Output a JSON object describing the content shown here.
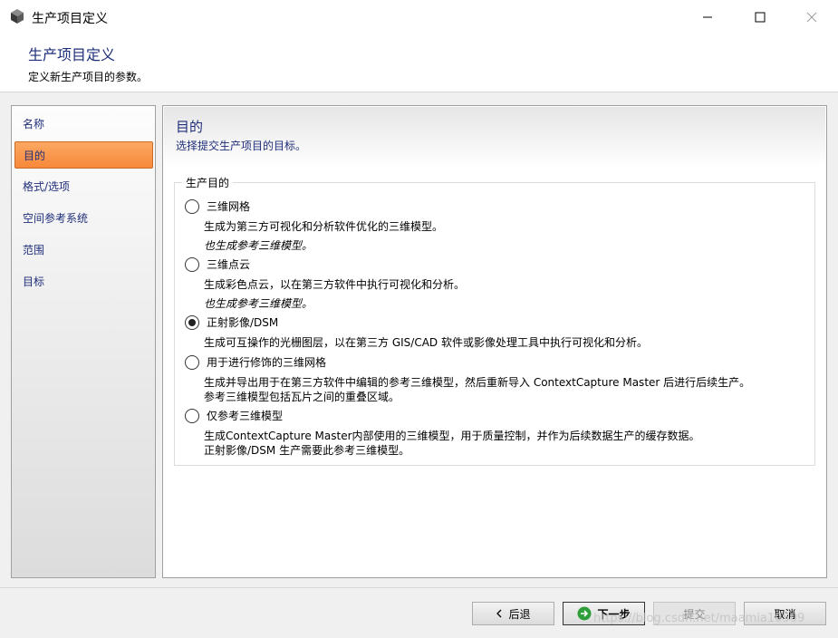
{
  "window": {
    "title": "生产项目定义"
  },
  "header": {
    "title": "生产项目定义",
    "subtitle": "定义新生产项目的参数。"
  },
  "sidebar": {
    "items": [
      {
        "label": "名称"
      },
      {
        "label": "目的"
      },
      {
        "label": "格式/选项"
      },
      {
        "label": "空间参考系统"
      },
      {
        "label": "范围"
      },
      {
        "label": "目标"
      }
    ],
    "active_label": "目的"
  },
  "main": {
    "title": "目的",
    "subtitle": "选择提交生产项目的目标。",
    "group_label": "生产目的",
    "options": [
      {
        "label": "三维网格",
        "checked": false,
        "desc": [
          "生成为第三方可视化和分析软件优化的三维模型。"
        ],
        "note": "也生成参考三维模型。"
      },
      {
        "label": "三维点云",
        "checked": false,
        "desc": [
          "生成彩色点云，以在第三方软件中执行可视化和分析。"
        ],
        "note": "也生成参考三维模型。"
      },
      {
        "label": "正射影像/DSM",
        "checked": true,
        "desc": [
          "生成可互操作的光栅图层，以在第三方 GIS/CAD 软件或影像处理工具中执行可视化和分析。"
        ]
      },
      {
        "label": "用于进行修饰的三维网格",
        "checked": false,
        "desc": [
          "生成并导出用于在第三方软件中编辑的参考三维模型，然后重新导入 ContextCapture Master 后进行后续生产。",
          "参考三维模型包括瓦片之间的重叠区域。"
        ]
      },
      {
        "label": "仅参考三维模型",
        "checked": false,
        "desc": [
          "生成ContextCapture Master内部使用的三维模型，用于质量控制，并作为后续数据生产的缓存数据。",
          "正射影像/DSM 生产需要此参考三维模型。"
        ]
      }
    ]
  },
  "footer": {
    "back_label": "后退",
    "next_label": "下一步",
    "submit_label": "提交",
    "cancel_label": "取消"
  },
  "watermark": "https://blog.csdn.net/maamia10509",
  "colors": {
    "accent_orange": "#f7883a",
    "link_blue": "#1f2e7a",
    "next_icon_green": "#2e9e3a"
  }
}
